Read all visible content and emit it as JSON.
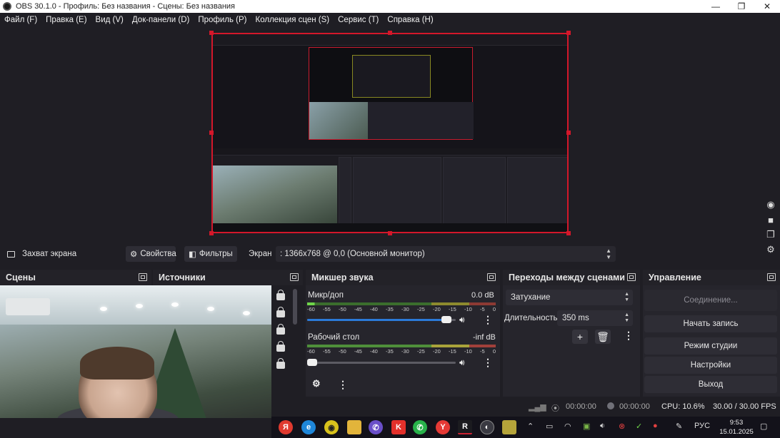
{
  "window": {
    "title": "OBS 30.1.0 - Профиль: Без названия - Сцены: Без названия",
    "controls": [
      "—",
      "❐",
      "✕"
    ]
  },
  "menu": [
    "Файл (F)",
    "Правка (E)",
    "Вид (V)",
    "Док-панели (D)",
    "Профиль (P)",
    "Коллекция сцен (S)",
    "Сервис (T)",
    "Справка (H)"
  ],
  "source_toolbar": {
    "source_name": "Захват экрана",
    "properties_label": "Свойства",
    "filters_label": "Фильтры",
    "screen_label": "Экран",
    "screen_value": ": 1366x768 @ 0,0 (Основной монитор)"
  },
  "docks": {
    "scenes": "Сцены",
    "sources": "Источники",
    "mixer": "Микшер звука",
    "transitions": "Переходы между сценами",
    "controls": "Управление"
  },
  "mixer": {
    "ticks": [
      "-60",
      "-55",
      "-50",
      "-45",
      "-40",
      "-35",
      "-30",
      "-25",
      "-20",
      "-15",
      "-10",
      "-5",
      "0"
    ],
    "channels": [
      {
        "name": "Микр/доп",
        "db": "0.0 dB",
        "volume": 0.97
      },
      {
        "name": "Рабочий стол",
        "db": "-inf dB",
        "volume": 0.0
      }
    ]
  },
  "transitions": {
    "selected": "Затухание",
    "duration_label": "Длительность",
    "duration_value": "350 ms"
  },
  "controls": {
    "connect": "Соединение...",
    "record": "Начать запись",
    "studio": "Режим студии",
    "settings": "Настройки",
    "exit": "Выход"
  },
  "status": {
    "stream_time": "00:00:00",
    "record_time": "00:00:00",
    "cpu": "CPU: 10.6%",
    "fps": "30.00 / 30.00 FPS"
  },
  "taskbar": {
    "lang": "РУС",
    "time": "9:53",
    "date": "15.01.2025"
  }
}
